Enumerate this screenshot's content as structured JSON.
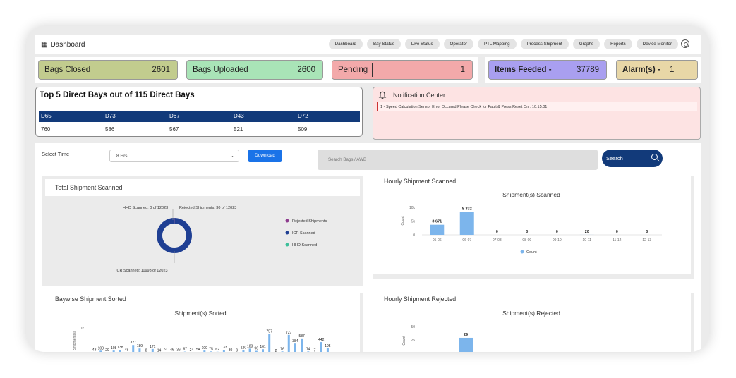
{
  "header": {
    "brand_icon": "dashboard-grid-icon",
    "title": "Dashboard",
    "nav": [
      "Dashboard",
      "Bay Status",
      "Live Status",
      "Operator",
      "PTL Mapping",
      "Process Shipment",
      "Graphs",
      "Reports",
      "Device Monitor"
    ],
    "settings_icon": "gear-icon"
  },
  "stats": {
    "bags_closed": {
      "label": "Bags Closed",
      "value": "2601",
      "color": "#c2cc8e"
    },
    "bags_uploaded": {
      "label": "Bags Uploaded",
      "value": "2600",
      "color": "#a9e4b7"
    },
    "pending": {
      "label": "Pending",
      "value": "1",
      "color": "#f3a9aa"
    },
    "items_feeded": {
      "label": "Items Feeded -",
      "value": "37789",
      "color": "#a99ff0"
    },
    "alarms": {
      "label": "Alarm(s) -",
      "value": "1",
      "color": "#e8d7a7"
    }
  },
  "top_bays": {
    "title": "Top 5 Direct Bays out of 115 Direct Bays",
    "headers": [
      "D65",
      "D73",
      "D67",
      "D43",
      "D72"
    ],
    "values": [
      "760",
      "586",
      "567",
      "521",
      "509"
    ]
  },
  "notifications": {
    "title": "Notification Center",
    "bell_icon": "bell-icon",
    "items": [
      "1 - Speed Calculation Sensor Error Occured,Please Check for Fault & Press Reset  On : 10:15:01"
    ]
  },
  "filters": {
    "select_label": "Select Time",
    "select_value": "8 Hrs",
    "download_label": "Download",
    "search_placeholder": "Search Bags / AWB",
    "search_label": "Search"
  },
  "panels": {
    "total_scanned_title": "Total Shipment Scanned",
    "hourly_scanned_title": "Hourly Shipment Scanned",
    "baywise_title": "Baywise Shipment Sorted",
    "hourly_rejected_title": "Hourly Shipment Rejected"
  },
  "chart_data": [
    {
      "type": "pie",
      "title": "",
      "labels": [
        "HHD Scanned: 0 of 12023",
        "Rejected Shipments: 30 of 12023",
        "ICR Scanned: 11993 of 12023"
      ],
      "series": [
        {
          "name": "Rejected Shipments",
          "value": 30,
          "color": "#8e3b8e"
        },
        {
          "name": "ICR Scanned",
          "value": 11993,
          "color": "#1f3f93"
        },
        {
          "name": "HHD Scanned",
          "value": 0,
          "color": "#3dbf9a"
        }
      ],
      "legend": "right"
    },
    {
      "type": "bar",
      "title": "Shipment(s) Scanned",
      "categories": [
        "05-06",
        "06-07",
        "07-08",
        "08-09",
        "09-10",
        "10-11",
        "11-12",
        "12-13"
      ],
      "values": [
        3671,
        8332,
        0,
        0,
        0,
        20,
        0,
        0
      ],
      "value_labels": [
        "3 671",
        "8 332",
        "0",
        "0",
        "0",
        "20",
        "0",
        "0"
      ],
      "ylabel": "Count",
      "yticks": [
        "0",
        "5k",
        "10k"
      ],
      "ylim": [
        0,
        10000
      ],
      "legend": "bottom",
      "legend_label": "Count",
      "color": "#7cb5ec"
    },
    {
      "type": "bar",
      "title": "Shipment(s) Sorted",
      "ylabel": "Shipment(s)",
      "yticks": [
        "1k"
      ],
      "ylim": [
        0,
        1000
      ],
      "values": [
        43,
        103,
        29,
        108,
        138,
        48,
        327,
        189,
        8,
        171,
        14,
        51,
        46,
        36,
        67,
        24,
        54,
        109,
        75,
        62,
        133,
        30,
        9,
        120,
        183,
        96,
        161,
        757,
        2,
        76,
        727,
        384,
        587,
        74,
        7,
        442,
        195
      ],
      "color": "#7cb5ec"
    },
    {
      "type": "bar",
      "title": "Shipment(s) Rejected",
      "ylabel": "Count",
      "yticks": [
        "25",
        "50"
      ],
      "ylim": [
        0,
        50
      ],
      "values": [
        1,
        29
      ],
      "value_labels": [
        "",
        "29"
      ],
      "color": "#7cb5ec"
    }
  ]
}
